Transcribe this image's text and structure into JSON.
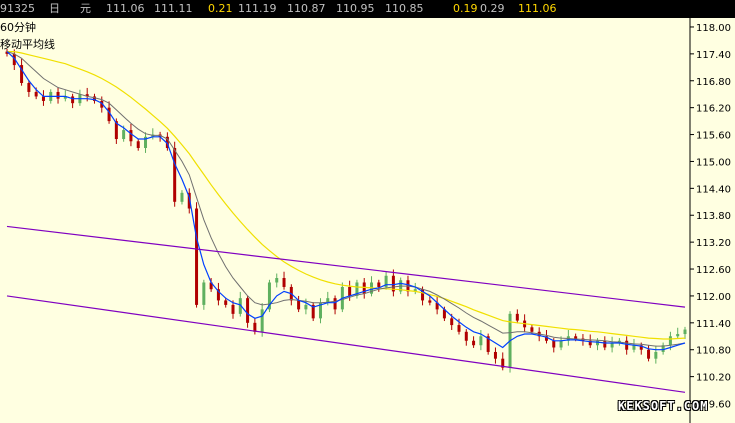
{
  "quote_bar": {
    "code": "91325",
    "period_unit": "日",
    "currency": "元",
    "values": [
      {
        "text": "111.06",
        "color": "#c0c0c0"
      },
      {
        "text": "111.11",
        "color": "#c0c0c0"
      },
      {
        "text": "0.21",
        "color": "#ffd700"
      },
      {
        "text": "111.19",
        "color": "#c0c0c0"
      },
      {
        "text": "110.87",
        "color": "#c0c0c0"
      },
      {
        "text": "110.95",
        "color": "#c0c0c0"
      },
      {
        "text": "110.85",
        "color": "#c0c0c0"
      },
      {
        "text": "0.19",
        "color": "#ffd700"
      },
      {
        "text": "0.29",
        "color": "#c0c0c0"
      },
      {
        "text": "111.06",
        "color": "#ffd700"
      }
    ]
  },
  "labels": {
    "timeframe": "60分钟",
    "indicator": "移动平均线"
  },
  "watermark": "KEKSOFT.COM",
  "colors": {
    "background": "#ffffe1",
    "up_candle": "#5fb05f",
    "down_candle": "#b00000",
    "ma_fast": "#0040ff",
    "ma_mid": "#707070",
    "ma_slow": "#f0e000",
    "channel": "#8000c0",
    "axis": "#000000"
  },
  "chart_data": {
    "type": "candlestick",
    "y_axis_position": "right",
    "ylim": [
      109.5,
      118.2
    ],
    "yticks": [
      "118.00",
      "117.40",
      "116.80",
      "116.20",
      "115.60",
      "115.00",
      "114.40",
      "113.80",
      "113.20",
      "112.60",
      "112.00",
      "111.40",
      "110.80",
      "110.20",
      "109.60"
    ],
    "close": [
      117.4,
      117.15,
      116.75,
      116.55,
      116.45,
      116.35,
      116.55,
      116.4,
      116.45,
      116.3,
      116.5,
      116.45,
      116.35,
      116.2,
      115.9,
      115.5,
      115.7,
      115.45,
      115.3,
      115.55,
      115.6,
      115.55,
      115.3,
      114.1,
      114.3,
      113.95,
      111.8,
      112.3,
      112.15,
      111.9,
      111.8,
      111.6,
      111.95,
      111.4,
      111.2,
      111.7,
      112.3,
      112.4,
      112.2,
      111.9,
      111.7,
      111.8,
      111.5,
      111.85,
      111.95,
      111.7,
      112.2,
      112.0,
      112.3,
      112.05,
      112.3,
      112.2,
      112.45,
      112.1,
      112.35,
      112.1,
      112.15,
      111.9,
      111.85,
      111.7,
      111.5,
      111.35,
      111.2,
      111.0,
      110.9,
      111.1,
      110.75,
      110.6,
      110.4,
      111.6,
      111.45,
      111.3,
      111.2,
      111.1,
      111.0,
      110.85,
      111.0,
      111.1,
      111.05,
      111.0,
      110.9,
      111.0,
      110.85,
      110.95,
      111.0,
      110.8,
      110.9,
      110.8,
      110.6,
      110.75,
      110.9,
      111.1,
      111.15,
      111.25
    ],
    "ma_fast": [
      117.45,
      117.3,
      117.05,
      116.8,
      116.6,
      116.45,
      116.45,
      116.45,
      116.45,
      116.4,
      116.4,
      116.4,
      116.38,
      116.3,
      116.1,
      115.85,
      115.75,
      115.62,
      115.5,
      115.5,
      115.55,
      115.55,
      115.4,
      114.95,
      114.6,
      114.2,
      113.3,
      112.7,
      112.3,
      112.1,
      111.95,
      111.85,
      111.8,
      111.6,
      111.5,
      111.55,
      111.8,
      112.0,
      112.1,
      112.05,
      111.9,
      111.85,
      111.75,
      111.8,
      111.85,
      111.85,
      111.95,
      112.0,
      112.05,
      112.1,
      112.15,
      112.18,
      112.25,
      112.25,
      112.28,
      112.25,
      112.2,
      112.1,
      112.0,
      111.85,
      111.7,
      111.55,
      111.42,
      111.3,
      111.2,
      111.15,
      111.05,
      110.95,
      110.85,
      111.0,
      111.1,
      111.15,
      111.15,
      111.12,
      111.08,
      111.0,
      111.0,
      111.02,
      111.02,
      111.0,
      110.98,
      110.97,
      110.95,
      110.95,
      110.95,
      110.92,
      110.9,
      110.88,
      110.82,
      110.8,
      110.8,
      110.85,
      110.9,
      110.95
    ],
    "ma_mid": [
      117.45,
      117.4,
      117.3,
      117.15,
      117.0,
      116.85,
      116.75,
      116.65,
      116.6,
      116.55,
      116.5,
      116.45,
      116.42,
      116.38,
      116.3,
      116.15,
      116.0,
      115.85,
      115.72,
      115.62,
      115.58,
      115.58,
      115.5,
      115.25,
      115.0,
      114.7,
      114.2,
      113.7,
      113.3,
      112.95,
      112.65,
      112.4,
      112.2,
      112.0,
      111.85,
      111.8,
      111.82,
      111.85,
      111.9,
      111.92,
      111.9,
      111.88,
      111.85,
      111.85,
      111.86,
      111.88,
      111.92,
      111.97,
      112.02,
      112.05,
      112.1,
      112.15,
      112.18,
      112.2,
      112.22,
      112.22,
      112.2,
      112.15,
      112.1,
      112.02,
      111.93,
      111.83,
      111.73,
      111.62,
      111.52,
      111.44,
      111.35,
      111.26,
      111.17,
      111.18,
      111.2,
      111.2,
      111.18,
      111.15,
      111.12,
      111.08,
      111.06,
      111.05,
      111.04,
      111.03,
      111.02,
      111.01,
      111.0,
      110.98,
      110.97,
      110.95,
      110.93,
      110.92,
      110.9,
      110.88,
      110.88,
      110.9,
      110.92,
      110.95
    ],
    "ma_slow": [
      117.45,
      117.45,
      117.42,
      117.38,
      117.34,
      117.3,
      117.26,
      117.22,
      117.18,
      117.12,
      117.06,
      117.0,
      116.93,
      116.85,
      116.76,
      116.66,
      116.55,
      116.43,
      116.3,
      116.17,
      116.03,
      115.89,
      115.74,
      115.56,
      115.37,
      115.17,
      114.94,
      114.71,
      114.48,
      114.26,
      114.05,
      113.85,
      113.66,
      113.48,
      113.31,
      113.15,
      113.01,
      112.88,
      112.76,
      112.66,
      112.57,
      112.49,
      112.42,
      112.36,
      112.31,
      112.27,
      112.24,
      112.22,
      112.2,
      112.19,
      112.18,
      112.17,
      112.16,
      112.15,
      112.14,
      112.12,
      112.1,
      112.07,
      112.03,
      111.99,
      111.94,
      111.88,
      111.82,
      111.76,
      111.69,
      111.63,
      111.57,
      111.51,
      111.45,
      111.42,
      111.4,
      111.38,
      111.36,
      111.34,
      111.32,
      111.3,
      111.28,
      111.26,
      111.25,
      111.23,
      111.21,
      111.2,
      111.18,
      111.16,
      111.14,
      111.12,
      111.1,
      111.08,
      111.06,
      111.05,
      111.04,
      111.04,
      111.05,
      111.06
    ],
    "channel_lines": [
      {
        "name": "upper",
        "from": [
          0,
          113.55
        ],
        "to": [
          93,
          111.75
        ]
      },
      {
        "name": "lower",
        "from": [
          0,
          112.0
        ],
        "to": [
          93,
          109.85
        ]
      }
    ]
  }
}
